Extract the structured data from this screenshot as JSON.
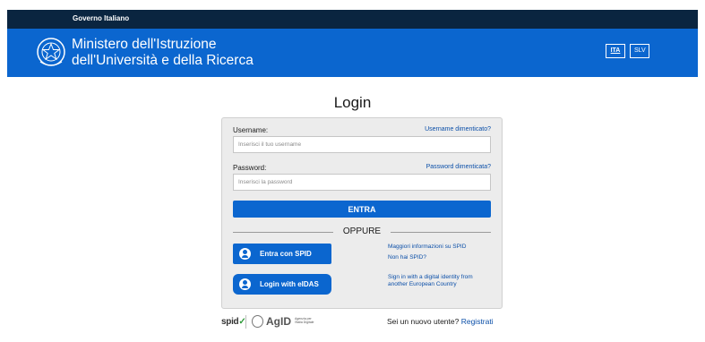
{
  "gov_bar": {
    "label": "Governo Italiano"
  },
  "header": {
    "title_line1": "Ministero dell'Istruzione",
    "title_line2": "dell'Università e della Ricerca",
    "languages": [
      {
        "label": "ITA",
        "active": true
      },
      {
        "label": "SLV",
        "active": false
      }
    ],
    "background_color": "#0b66cf"
  },
  "login": {
    "title": "Login",
    "username_label": "Username:",
    "username_placeholder": "Inserisci il tuo username",
    "username_value": "",
    "forgot_username": "Username dimenticato?",
    "password_label": "Password:",
    "password_placeholder": "Inserisci la password",
    "password_value": "",
    "forgot_password": "Password dimenticata?",
    "submit_label": "ENTRA",
    "separator_label": "OPPURE",
    "spid_button": "Entra con SPID",
    "spid_info": "Maggiori informazioni su SPID",
    "spid_missing": "Non hai SPID?",
    "eidas_button": "Login with eIDAS",
    "eidas_info_line1": "Sign in with a digital identity from",
    "eidas_info_line2": "another European Country"
  },
  "footer": {
    "spid_logo": "spid",
    "agid_logo": "AgID",
    "agid_sub_line1": "Agenzia per",
    "agid_sub_line2": "l'Italia Digitale",
    "new_user_text": "Sei un nuovo utente?",
    "register_link": "Registrati"
  }
}
